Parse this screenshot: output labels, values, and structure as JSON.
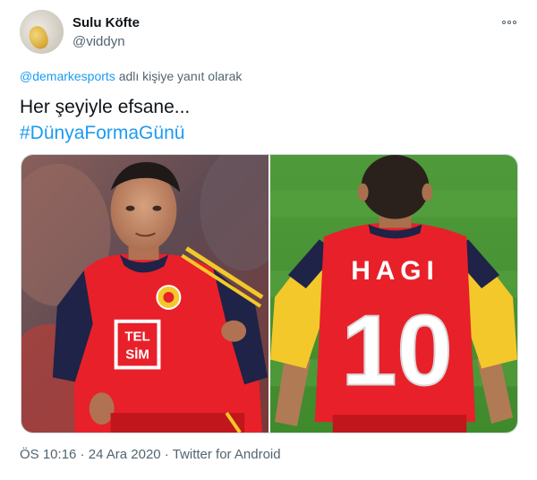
{
  "user": {
    "display_name": "Sulu Köfte",
    "handle": "@viddyn"
  },
  "reply_to": {
    "mention": "@demarkesports",
    "suffix": " adlı kişiye yanıt olarak"
  },
  "tweet": {
    "text": "Her şeyiyle efsane...",
    "hashtag": "#DünyaFormaGünü"
  },
  "media": {
    "photo1_sponsor_line1": "TEL",
    "photo1_sponsor_line2": "SİM",
    "photo2_name": "HAGI",
    "photo2_number": "10"
  },
  "meta": {
    "time": "ÖS 10:16",
    "sep1": " · ",
    "date": "24 Ara 2020",
    "sep2": " · ",
    "source": "Twitter for Android"
  },
  "colors": {
    "link": "#1d9bf0",
    "secondary_text": "#536471",
    "kit_red": "#e8202a",
    "kit_yellow": "#f3c82a",
    "kit_navy": "#1e2347"
  },
  "icons": {
    "more": "more-options-icon"
  }
}
